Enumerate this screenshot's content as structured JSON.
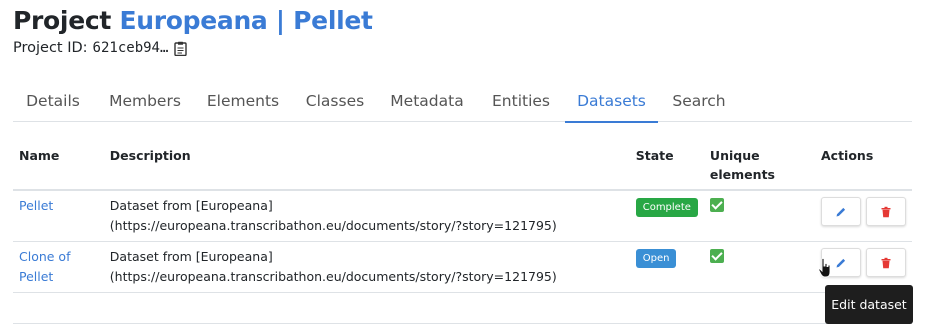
{
  "header": {
    "title_prefix": "Project",
    "project_name": "Europeana | Pellet",
    "project_id_label": "Project ID:",
    "project_id_value": "621ceb94…"
  },
  "tabs": [
    {
      "label": "Details",
      "active": false
    },
    {
      "label": "Members",
      "active": false
    },
    {
      "label": "Elements",
      "active": false
    },
    {
      "label": "Classes",
      "active": false
    },
    {
      "label": "Metadata",
      "active": false
    },
    {
      "label": "Entities",
      "active": false
    },
    {
      "label": "Datasets",
      "active": true
    },
    {
      "label": "Search",
      "active": false
    }
  ],
  "table": {
    "columns": [
      "Name",
      "Description",
      "State",
      "Unique elements",
      "Actions"
    ],
    "rows": [
      {
        "name": "Pellet",
        "description": "Dataset from [Europeana](https://europeana.transcribathon.eu/documents/story/?story=121795)",
        "state": "Complete",
        "unique_elements": true
      },
      {
        "name": "Clone of Pellet",
        "description": "Dataset from [Europeana](https://europeana.transcribathon.eu/documents/story/?story=121795)",
        "state": "Open",
        "unique_elements": true
      }
    ]
  },
  "tooltip": {
    "text": "Edit dataset"
  },
  "colors": {
    "accent": "#3a7bd5",
    "complete_badge": "#28a745",
    "open_badge": "#3a8fd5",
    "delete_icon": "#e53935",
    "check": "#4caf50"
  },
  "icons": {
    "copy": "clipboard-icon",
    "edit": "pencil-icon",
    "delete": "trash-icon",
    "unique": "check-icon"
  }
}
